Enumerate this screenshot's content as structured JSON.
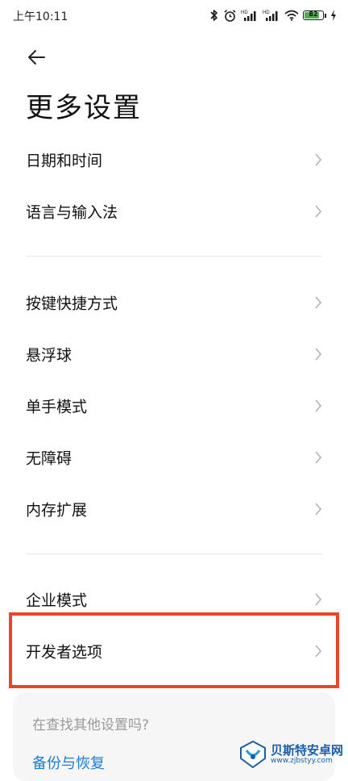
{
  "status": {
    "time": "上午10:11",
    "battery": "82",
    "battery_level": 0.82,
    "signal1_tag": "HD",
    "signal2_tag": "HD"
  },
  "page": {
    "title": "更多设置"
  },
  "groups": [
    {
      "items": [
        {
          "label": "日期和时间"
        },
        {
          "label": "语言与输入法"
        }
      ]
    },
    {
      "items": [
        {
          "label": "按键快捷方式"
        },
        {
          "label": "悬浮球"
        },
        {
          "label": "单手模式"
        },
        {
          "label": "无障碍"
        },
        {
          "label": "内存扩展"
        }
      ]
    },
    {
      "items": [
        {
          "label": "企业模式"
        },
        {
          "label": "开发者选项"
        }
      ]
    }
  ],
  "suggestion": {
    "title": "在查找其他设置吗?",
    "link": "备份与恢复"
  },
  "watermark": {
    "name": "贝斯特安卓网",
    "url": "www.zjbstyy.com"
  },
  "colors": {
    "highlight": "#e8452a",
    "link": "#1a7cd6",
    "battery": "#4caf50"
  }
}
